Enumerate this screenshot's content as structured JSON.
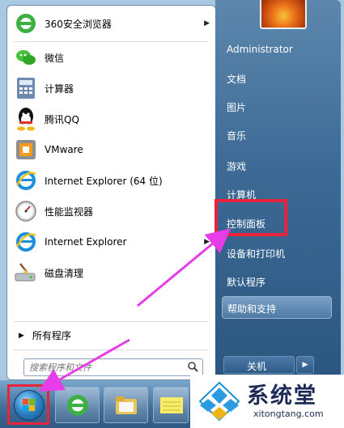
{
  "programs": [
    {
      "label": "360安全浏览器",
      "icon": "360-browser-icon",
      "has_submenu": true
    },
    {
      "label": "微信",
      "icon": "wechat-icon",
      "has_submenu": false
    },
    {
      "label": "计算器",
      "icon": "calculator-icon",
      "has_submenu": false
    },
    {
      "label": "腾讯QQ",
      "icon": "qq-icon",
      "has_submenu": false
    },
    {
      "label": "VMware",
      "icon": "vmware-icon",
      "has_submenu": false
    },
    {
      "label": "Internet Explorer (64 位)",
      "icon": "ie-icon",
      "has_submenu": false
    },
    {
      "label": "性能监视器",
      "icon": "performance-monitor-icon",
      "has_submenu": false
    },
    {
      "label": "Internet Explorer",
      "icon": "ie-icon",
      "has_submenu": true
    },
    {
      "label": "磁盘清理",
      "icon": "disk-cleanup-icon",
      "has_submenu": false
    }
  ],
  "all_programs": "所有程序",
  "search": {
    "placeholder": "搜索程序和文件"
  },
  "right_pane": {
    "username": "Administrator",
    "documents": "文档",
    "pictures": "图片",
    "music": "音乐",
    "games": "游戏",
    "computer": "计算机",
    "control_panel": "控制面板",
    "devices_printers": "设备和打印机",
    "default_programs": "默认程序",
    "help_support": "帮助和支持"
  },
  "shutdown": {
    "label": "关机"
  },
  "watermark": {
    "title": "系统堂",
    "url": "xitongtang.com"
  },
  "colors": {
    "highlight": "#e8243c",
    "arrow": "#e83ce8",
    "right_pane": "#3c6a95"
  }
}
